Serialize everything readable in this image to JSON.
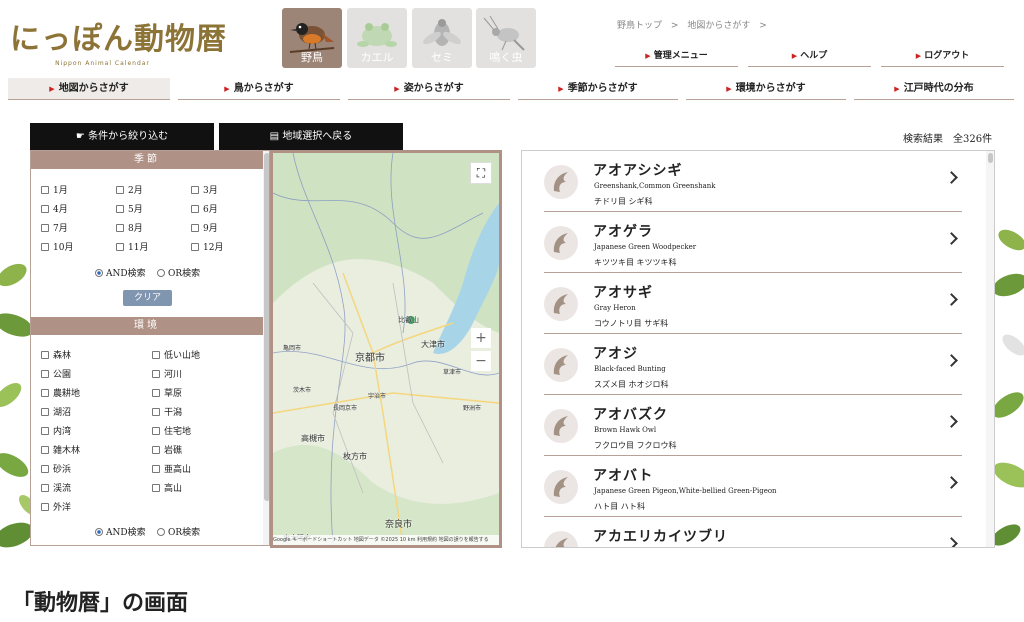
{
  "logo": {
    "title": "にっぽん動物暦",
    "subtitle": "Nippon Animal Calendar"
  },
  "categories": [
    {
      "label": "野鳥",
      "icon": "bird-icon",
      "active": true
    },
    {
      "label": "カエル",
      "icon": "frog-icon",
      "active": false
    },
    {
      "label": "セミ",
      "icon": "cicada-icon",
      "active": false
    },
    {
      "label": "鳴く虫",
      "icon": "cricket-icon",
      "active": false
    }
  ],
  "breadcrumb": {
    "home": "野鳥トップ",
    "sep": ">",
    "current": "地図からさがす",
    "trail": ">"
  },
  "topmenu": [
    "管理メニュー",
    "ヘルプ",
    "ログアウト"
  ],
  "nav_tabs": [
    "地図からさがす",
    "鳥からさがす",
    "姿からさがす",
    "季節からさがす",
    "環境からさがす",
    "江戸時代の分布"
  ],
  "buttons": {
    "filter": "条件から絞り込む",
    "region": "地域選択へ戻る",
    "clear": "クリア"
  },
  "season": {
    "heading": "季節",
    "months": [
      "1月",
      "2月",
      "3月",
      "4月",
      "5月",
      "6月",
      "7月",
      "8月",
      "9月",
      "10月",
      "11月",
      "12月"
    ],
    "and_label": "AND検索",
    "or_label": "OR検索"
  },
  "environment": {
    "heading": "環境",
    "items": [
      "森林",
      "低い山地",
      "公園",
      "河川",
      "農耕地",
      "草原",
      "湖沼",
      "干潟",
      "内湾",
      "住宅地",
      "雑木林",
      "岩礁",
      "砂浜",
      "亜高山",
      "渓流",
      "高山",
      "外洋"
    ],
    "and_label": "AND検索",
    "or_label": "OR検索"
  },
  "map": {
    "labels": [
      "京都市",
      "大津市",
      "比叡山",
      "高槻市",
      "枚方市",
      "奈良市",
      "宇治市",
      "草津市",
      "茨木市",
      "亀岡市",
      "東大阪市",
      "長岡京市",
      "野洲市"
    ],
    "zoom_in": "+",
    "zoom_out": "−",
    "attribution": "Google  キーボードショートカット  地図データ ©2025  10 km  利用規約  地図の誤りを報告する"
  },
  "results": {
    "count_label": "検索結果　全326件",
    "items": [
      {
        "name": "アオアシシギ",
        "english": "Greenshank,Common Greenshank",
        "family": "チドリ目 シギ科"
      },
      {
        "name": "アオゲラ",
        "english": "Japanese Green Woodpecker",
        "family": "キツツキ目 キツツキ科"
      },
      {
        "name": "アオサギ",
        "english": "Gray Heron",
        "family": "コウノトリ目 サギ科"
      },
      {
        "name": "アオジ",
        "english": "Black-faced Bunting",
        "family": "スズメ目 ホオジロ科"
      },
      {
        "name": "アオバズク",
        "english": "Brown Hawk Owl",
        "family": "フクロウ目 フクロウ科"
      },
      {
        "name": "アオバト",
        "english": "Japanese Green Pigeon,White-bellied Green-Pigeon",
        "family": "ハト目 ハト科"
      },
      {
        "name": "アカエリカイツブリ",
        "english": "",
        "family": ""
      }
    ]
  },
  "caption": "「動物暦」の画面",
  "colors": {
    "accent": "#b09186",
    "logo": "#8c7336",
    "arrow": "#cc2222",
    "button": "#111111",
    "clear": "#7f95b0"
  }
}
